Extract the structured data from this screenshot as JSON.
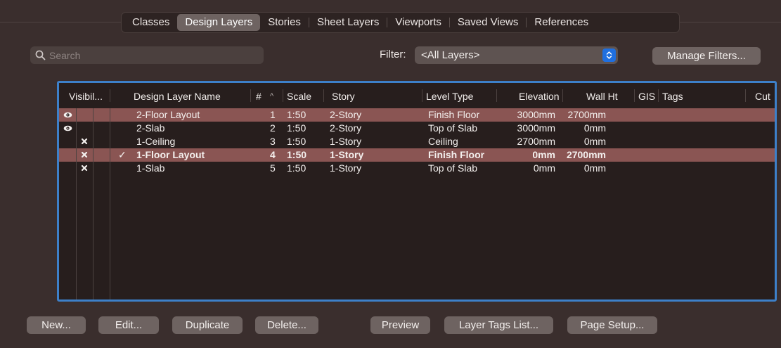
{
  "tabs": [
    "Classes",
    "Design Layers",
    "Stories",
    "Sheet Layers",
    "Viewports",
    "Saved Views",
    "References"
  ],
  "active_tab": "Design Layers",
  "search": {
    "placeholder": "Search"
  },
  "filter": {
    "label": "Filter:",
    "value": "<All Layers>"
  },
  "manage_filters_label": "Manage Filters...",
  "table": {
    "headers": {
      "visibility": "Visibil...",
      "name": "Design Layer Name",
      "number": "#",
      "sort_indicator": "^",
      "scale": "Scale",
      "story": "Story",
      "level_type": "Level Type",
      "elevation": "Elevation",
      "wall_ht": "Wall Ht",
      "gis": "GIS",
      "tags": "Tags",
      "cut": "Cut"
    },
    "rows": [
      {
        "visibility": "visible",
        "active": false,
        "name": "2-Floor Layout",
        "number": "1",
        "scale": "1:50",
        "story": "2-Story",
        "level_type": "Finish Floor",
        "elevation": "3000mm",
        "wall_ht": "2700mm",
        "highlighted": true
      },
      {
        "visibility": "visible",
        "active": false,
        "name": "2-Slab",
        "number": "2",
        "scale": "1:50",
        "story": "2-Story",
        "level_type": "Top of Slab",
        "elevation": "3000mm",
        "wall_ht": "0mm",
        "highlighted": false
      },
      {
        "visibility": "hidden",
        "active": false,
        "name": "1-Ceiling",
        "number": "3",
        "scale": "1:50",
        "story": "1-Story",
        "level_type": "Ceiling",
        "elevation": "2700mm",
        "wall_ht": "0mm",
        "highlighted": false
      },
      {
        "visibility": "hidden",
        "active": true,
        "name": "1-Floor Layout",
        "number": "4",
        "scale": "1:50",
        "story": "1-Story",
        "level_type": "Finish Floor",
        "elevation": "0mm",
        "wall_ht": "2700mm",
        "highlighted": true
      },
      {
        "visibility": "hidden",
        "active": false,
        "name": "1-Slab",
        "number": "5",
        "scale": "1:50",
        "story": "1-Story",
        "level_type": "Top of Slab",
        "elevation": "0mm",
        "wall_ht": "0mm",
        "highlighted": false
      }
    ],
    "active_mark": "✓"
  },
  "buttons": {
    "new": "New...",
    "edit": "Edit...",
    "duplicate": "Duplicate",
    "delete": "Delete...",
    "preview": "Preview",
    "layer_tags_list": "Layer Tags List...",
    "page_setup": "Page Setup..."
  },
  "colors": {
    "background": "#3a2e2d",
    "table_background": "#271e1d",
    "highlight_row": "#8a5553",
    "focus_border": "#3d80c9",
    "accent_blue": "#1f6fe0"
  }
}
